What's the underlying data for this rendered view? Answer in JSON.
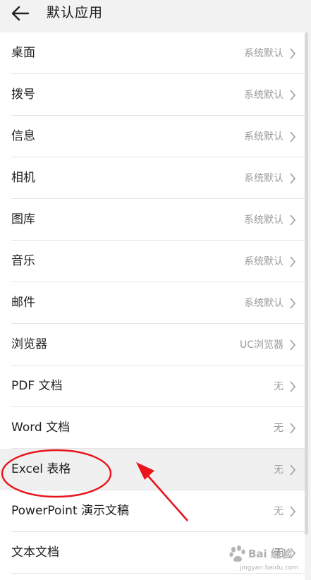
{
  "header": {
    "title": "默认应用"
  },
  "rows": [
    {
      "label": "桌面",
      "value": "系统默认"
    },
    {
      "label": "拨号",
      "value": "系统默认"
    },
    {
      "label": "信息",
      "value": "系统默认"
    },
    {
      "label": "相机",
      "value": "系统默认"
    },
    {
      "label": "图库",
      "value": "系统默认"
    },
    {
      "label": "音乐",
      "value": "系统默认"
    },
    {
      "label": "邮件",
      "value": "系统默认"
    },
    {
      "label": "浏览器",
      "value": "UC浏览器"
    },
    {
      "label": "PDF 文档",
      "value": "无"
    },
    {
      "label": "Word 文档",
      "value": "无"
    },
    {
      "label": "Excel 表格",
      "value": "无"
    },
    {
      "label": "PowerPoint 演示文稿",
      "value": "无"
    },
    {
      "label": "文本文档",
      "value": "无"
    }
  ],
  "watermark": {
    "brand": "Bai 经验",
    "url": "jingyan.baidu.com"
  },
  "colors": {
    "annotation": "#e8141c"
  }
}
